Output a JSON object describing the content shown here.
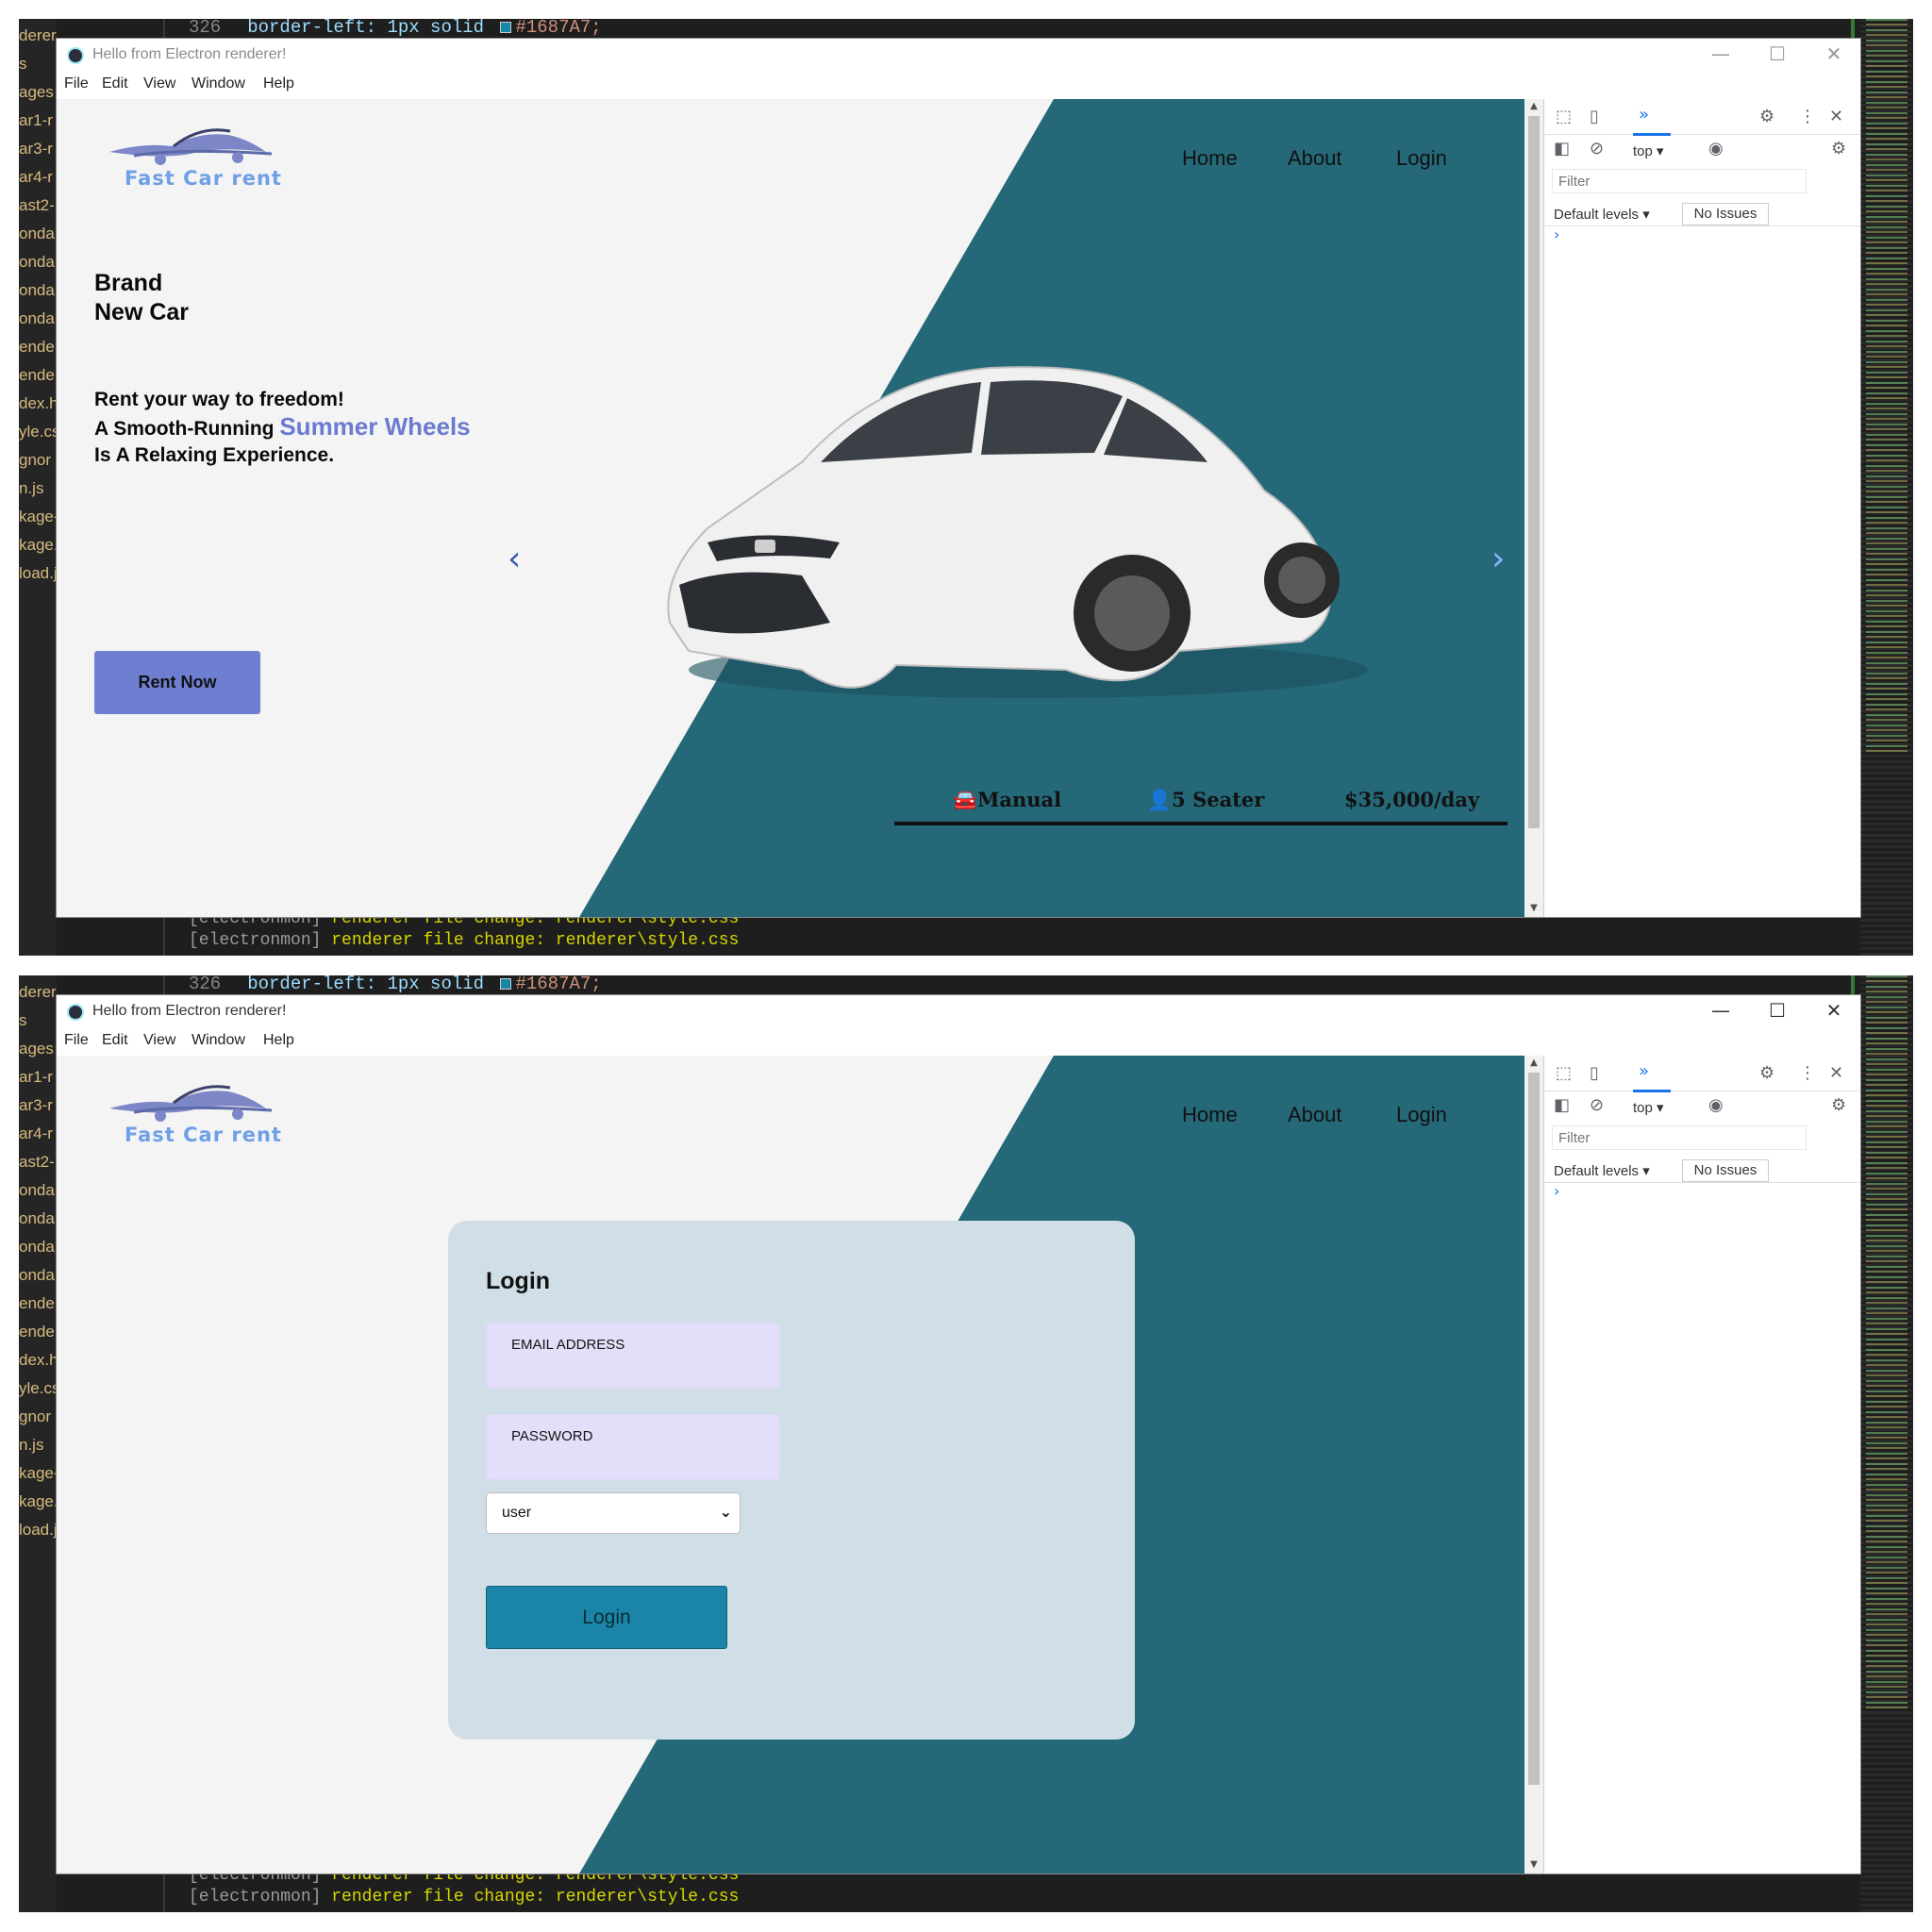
{
  "editor": {
    "code_line_number": "326",
    "code_line": "border-left: 1px solid ",
    "code_color": "#1687A7;",
    "sidebar_files": [
      "derer",
      "s",
      "ages",
      "ar1-r",
      "ar3-r",
      "ar4-r",
      "ast2-",
      "onda",
      "onda",
      "onda",
      "onda",
      "ende",
      "ende",
      "dex.h",
      "yle.css",
      "gnor",
      "n.js",
      "kage-",
      "kage.",
      "load.j"
    ],
    "terminal_lines": [
      {
        "tag": "[electronmon]",
        "msg": " renderer file change: renderer\\style.css"
      },
      {
        "tag": "[electronmon]",
        "msg": " renderer file change: renderer\\style.css"
      },
      {
        "tag": "[electronmon]",
        "msg": " renderer file change: renderer\\style.css"
      }
    ]
  },
  "window": {
    "title": "Hello from Electron renderer!",
    "controls": {
      "minimize": "—",
      "maximize": "☐",
      "close": "✕"
    },
    "menu": [
      "File",
      "Edit",
      "View",
      "Window",
      "Help"
    ]
  },
  "site": {
    "logo_text": "Fast Car rent",
    "nav": [
      "Home",
      "About",
      "Login"
    ]
  },
  "home": {
    "brand_line1": "Brand",
    "brand_line2": "New Car",
    "tagline_line1": "Rent your way to freedom!",
    "tagline_line2_pre": "A Smooth-Running ",
    "tagline_highlight": "Summer Wheels",
    "tagline_line3": "Is A Relaxing Experience.",
    "cta": "Rent Now",
    "prev_arrow": "‹",
    "next_arrow": "›",
    "specs": {
      "transmission": "Manual",
      "seats": "5 Seater",
      "price": "$35,000/day"
    }
  },
  "login": {
    "title": "Login",
    "email_label": "EMAIL ADDRESS",
    "password_label": "PASSWORD",
    "role_selected": "user",
    "submit": "Login"
  },
  "devtools": {
    "more_tabs": "»",
    "context": "top",
    "filter_placeholder": "Filter",
    "levels": "Default levels",
    "issues": "No Issues",
    "prompt": "›"
  },
  "colors": {
    "teal": "#256878",
    "accent": "#6e7fd2",
    "login_button": "#1a85a8",
    "card_bg": "#d0dfe7",
    "input_bg": "#e3dffa"
  }
}
